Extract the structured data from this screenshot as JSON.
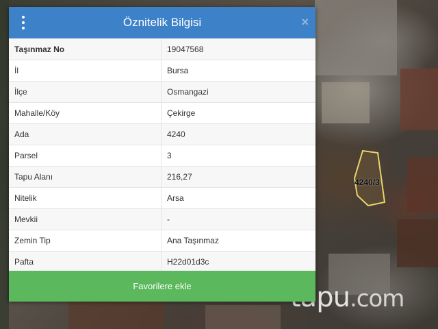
{
  "dialog": {
    "title": "Öznitelik Bilgisi",
    "close_symbol": "×",
    "rows": [
      {
        "key": "Taşınmaz No",
        "value": "19047568"
      },
      {
        "key": "İl",
        "value": "Bursa"
      },
      {
        "key": "İlçe",
        "value": "Osmangazi"
      },
      {
        "key": "Mahalle/Köy",
        "value": "Çekirge"
      },
      {
        "key": "Ada",
        "value": "4240"
      },
      {
        "key": "Parsel",
        "value": "3"
      },
      {
        "key": "Tapu Alanı",
        "value": "216,27"
      },
      {
        "key": "Nitelik",
        "value": "Arsa"
      },
      {
        "key": "Mevkii",
        "value": "-"
      },
      {
        "key": "Zemin Tip",
        "value": "Ana Taşınmaz"
      },
      {
        "key": "Pafta",
        "value": "H22d01d3c"
      }
    ],
    "favorite_button": "Favorilere ekle"
  },
  "map": {
    "parcel_label": "4240/3"
  },
  "watermark": {
    "brand": "tapu",
    "domain": ".com"
  },
  "colors": {
    "header": "#3d82c8",
    "button": "#5cb85c",
    "parcel_outline": "#e8d36a"
  },
  "icons": {
    "menu": "vertical-dots-icon",
    "close": "close-icon"
  }
}
